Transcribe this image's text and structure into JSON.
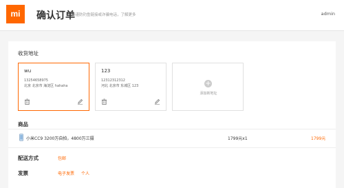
{
  "header": {
    "logo": "mi",
    "title": "确认订单",
    "subtitle": "请谨防钓鱼链接或诈骗电话，了解更多",
    "user": "admin"
  },
  "address": {
    "section_title": "收货地址",
    "cards": [
      {
        "name": "wu",
        "phone": "13254658975",
        "detail": "北京 北京市 海淀区 hahaha",
        "selected": true
      },
      {
        "name": "123",
        "phone": "12312312312",
        "detail": "河北 北京市 东城区 123",
        "selected": false
      }
    ],
    "add_label": "添加新地址"
  },
  "goods": {
    "section_title": "商品",
    "items": [
      {
        "name": "小米CC9 3200万自拍，4800万三摄",
        "price_qty": "1799元x1",
        "total": "1799元"
      }
    ]
  },
  "delivery": {
    "section_title": "配送方式",
    "value": "包邮"
  },
  "invoice": {
    "section_title": "发票",
    "options": [
      "电子发票",
      "个人"
    ]
  },
  "colors": {
    "accent": "#ff6700",
    "card_border": "#e0e0e0"
  }
}
